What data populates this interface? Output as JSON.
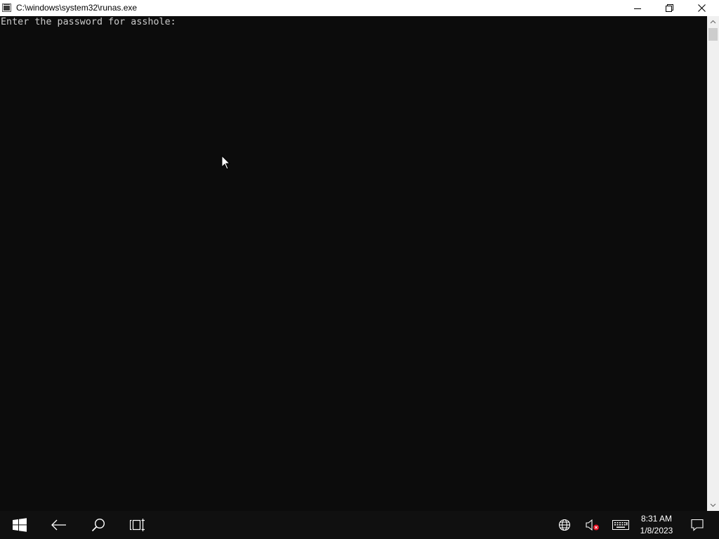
{
  "window": {
    "title": "C:\\windows\\system32\\runas.exe",
    "icon": "console-app-icon",
    "controls": [
      "minimize-icon",
      "restore-icon",
      "close-icon"
    ]
  },
  "console": {
    "lines": [
      "Enter the password for asshole:"
    ],
    "background": "#0c0c0c",
    "foreground": "#cccccc"
  },
  "taskbar": {
    "items": [
      "windows-start-icon",
      "back-arrow-icon",
      "search-icon",
      "task-view-icon"
    ],
    "tray": {
      "icons": [
        "globe-network-icon",
        "speaker-muted-icon",
        "touch-keyboard-icon"
      ],
      "time": "8:31 AM",
      "date": "1/8/2023",
      "notification_icon": "action-center-icon"
    },
    "background": "#101010"
  }
}
